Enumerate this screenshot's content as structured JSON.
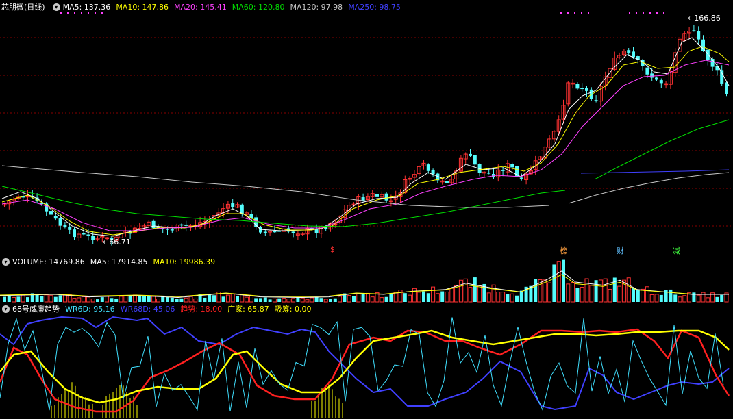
{
  "main": {
    "title": "芯朋微(日线)",
    "ma_items": [
      {
        "text": "MA5: 137.36",
        "color": "#ffffff"
      },
      {
        "text": "MA10: 147.86",
        "color": "#ffff00"
      },
      {
        "text": "MA20: 145.41",
        "color": "#ff40ff"
      },
      {
        "text": "MA60: 120.80",
        "color": "#00e000"
      },
      {
        "text": "MA120: 97.98",
        "color": "#c8c8c8"
      },
      {
        "text": "MA250: 98.75",
        "color": "#4040ff"
      }
    ],
    "high_label": "166.86",
    "low_label": "66.71",
    "markers": [
      {
        "text": "$",
        "color": "#ff3030"
      },
      {
        "text": "榜",
        "color": "#ffa040"
      },
      {
        "text": "财",
        "color": "#60c0ff"
      },
      {
        "text": "减",
        "color": "#40ff40"
      }
    ]
  },
  "volume": {
    "items": [
      {
        "text": "VOLUME: 14769.86",
        "color": "#ffffff"
      },
      {
        "text": "MA5: 17914.85",
        "color": "#ffffff"
      },
      {
        "text": "MA10: 19986.39",
        "color": "#ffff00"
      }
    ]
  },
  "indicator": {
    "items": [
      {
        "text": "68号威廉趋势",
        "color": "#ffffff"
      },
      {
        "text": "WR6D: 95.16",
        "color": "#40e0ff"
      },
      {
        "text": "WR68D: 45.06",
        "color": "#4040ff"
      },
      {
        "text": "趋势: 18.00",
        "color": "#ff2020"
      },
      {
        "text": "庄家: 65.87",
        "color": "#ffff00"
      },
      {
        "text": "吸筹: 0.00",
        "color": "#ffff00"
      }
    ]
  },
  "colors": {
    "up": "#ff3232",
    "down": "#54fcfc",
    "grid": "#8a0000",
    "ma5": "#ffffff",
    "ma10": "#ffff00",
    "ma20": "#ff40ff",
    "ma60": "#00e000",
    "ma120": "#c8c8c8",
    "ma250": "#4040ff"
  }
}
